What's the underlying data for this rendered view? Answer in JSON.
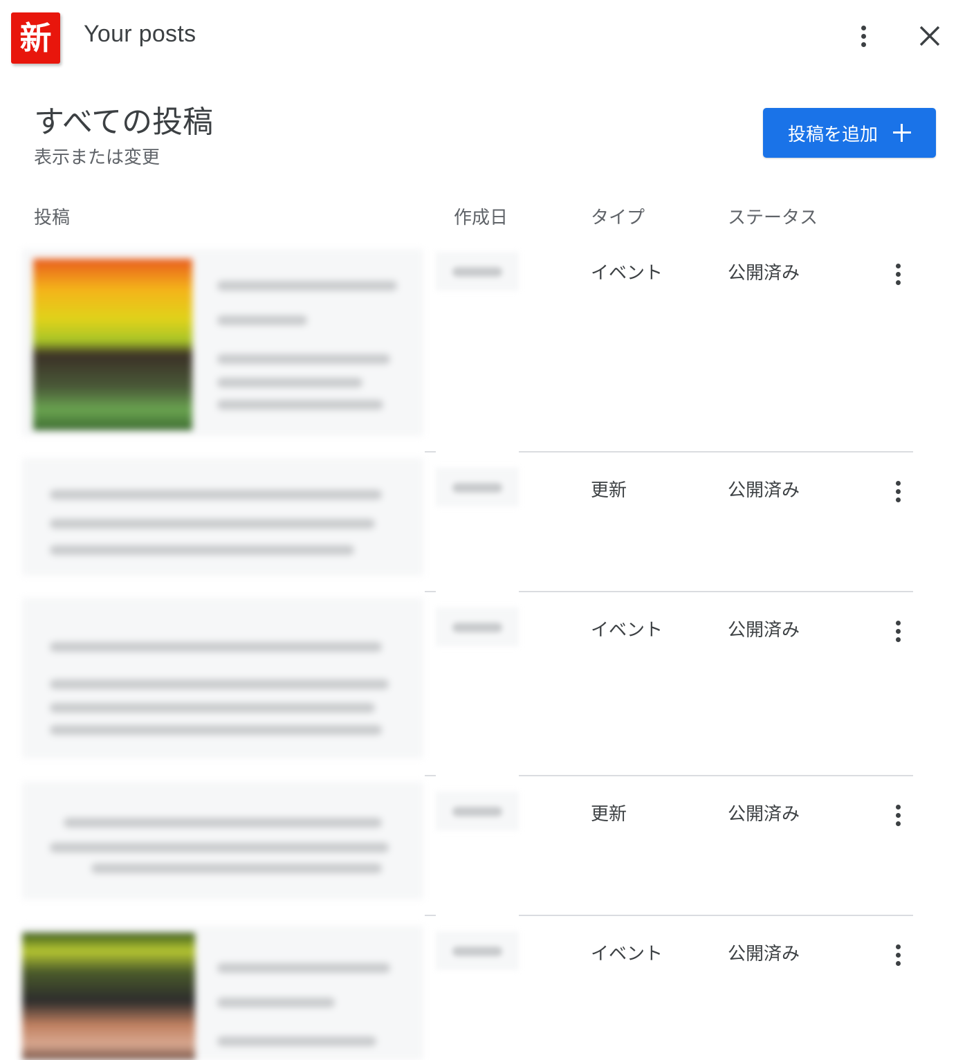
{
  "header": {
    "logo_text": "新",
    "title": "Your posts",
    "more_icon": "more-vert-icon",
    "close_icon": "close-icon"
  },
  "section": {
    "title": "すべての投稿",
    "subtitle": "表示または変更",
    "add_button_label": "投稿を追加",
    "add_icon": "plus-icon"
  },
  "columns": {
    "post": "投稿",
    "created": "作成日",
    "type": "タイプ",
    "status": "ステータス"
  },
  "posts": [
    {
      "type": "イベント",
      "status": "公開済み",
      "has_image": true
    },
    {
      "type": "更新",
      "status": "公開済み",
      "has_image": false
    },
    {
      "type": "イベント",
      "status": "公開済み",
      "has_image": false
    },
    {
      "type": "更新",
      "status": "公開済み",
      "has_image": false
    },
    {
      "type": "イベント",
      "status": "公開済み",
      "has_image": true
    }
  ],
  "colors": {
    "accent": "#1a73e8",
    "logo_red": "#e8160c",
    "text": "#3c4043",
    "divider": "#dadce0"
  }
}
